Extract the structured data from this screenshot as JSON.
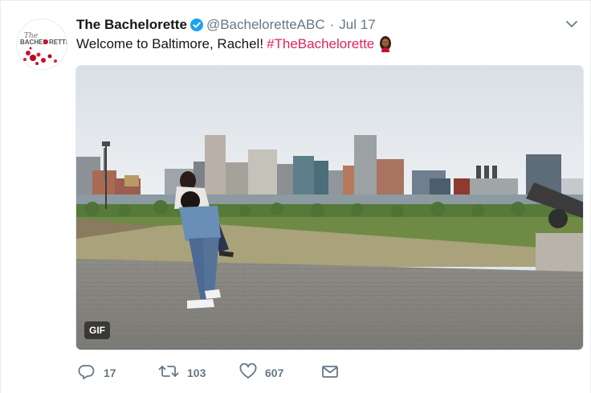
{
  "tweet": {
    "author": {
      "fullname": "The Bachelorette",
      "username": "@BacheloretteABC",
      "verified": true,
      "avatar_logo": "The BACHELORETTE"
    },
    "separator": "·",
    "timestamp": "Jul 17",
    "text": "Welcome to Baltimore, Rachel!",
    "hashtag": "#TheBachelorette",
    "media": {
      "badge": "GIF",
      "description_icon": "gif-video"
    },
    "actions": {
      "reply": {
        "icon": "reply-icon",
        "count": "17"
      },
      "retweet": {
        "icon": "retweet-icon",
        "count": "103"
      },
      "like": {
        "icon": "heart-icon",
        "count": "607"
      },
      "dm": {
        "icon": "envelope-icon"
      }
    }
  },
  "colors": {
    "verified_blue": "#1da1f2",
    "hashtag_red": "#e0245e",
    "secondary_text": "#657786",
    "primary_text": "#14171a"
  }
}
